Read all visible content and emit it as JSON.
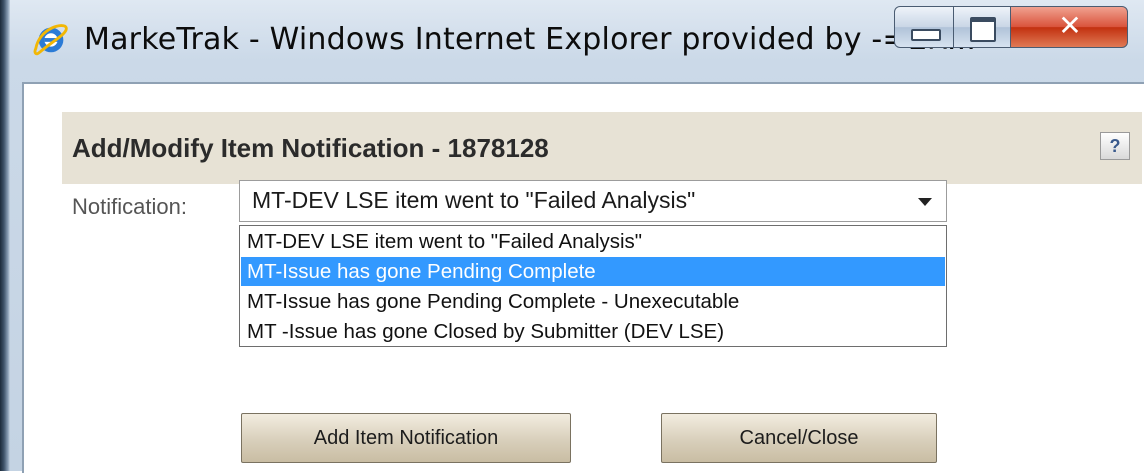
{
  "window": {
    "title": "MarkeTrak - Windows Internet Explorer provided by -=ER...",
    "close_glyph": "✕",
    "controls": [
      "minimize-icon",
      "maximize-icon",
      "close-icon"
    ]
  },
  "dialog": {
    "title": "Add/Modify Item Notification - 1878128",
    "help_label": "?"
  },
  "form": {
    "notification_label": "Notification:",
    "selected_value": "MT-DEV LSE item went to \"Failed Analysis\"",
    "options": [
      "MT-DEV LSE item went to \"Failed Analysis\"",
      "MT-Issue has gone Pending Complete",
      "MT-Issue has gone Pending Complete - Unexecutable",
      "MT -Issue has gone Closed by Submitter (DEV LSE)"
    ],
    "highlighted_option_index": 1
  },
  "buttons": {
    "add_label": "Add Item Notification",
    "cancel_label": "Cancel/Close"
  },
  "colors": {
    "highlight": "#3399ff",
    "header_band": "#e7e2d5",
    "close_button": "#c2300f"
  }
}
